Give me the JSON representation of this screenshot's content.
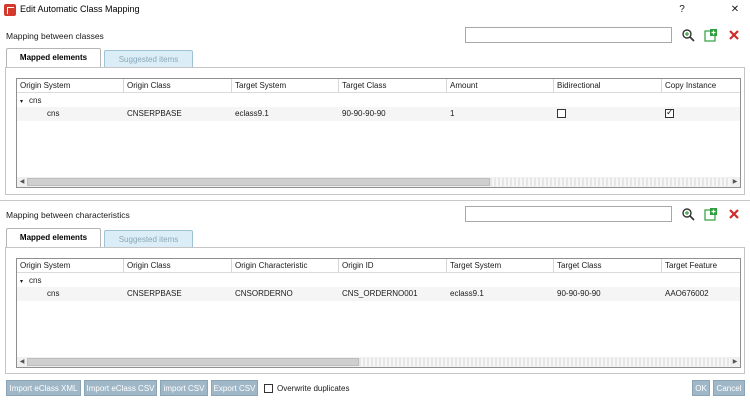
{
  "window": {
    "title": "Edit Automatic Class Mapping",
    "help": "?",
    "close": "✕"
  },
  "classes": {
    "label": "Mapping between classes",
    "search_value": "",
    "tabs": {
      "mapped": "Mapped elements",
      "suggested": "Suggested items"
    },
    "columns": [
      "Origin System",
      "Origin Class",
      "Target System",
      "Target Class",
      "Amount",
      "Bidirectional",
      "Copy Instance"
    ],
    "group": "cns",
    "rows": [
      {
        "origin_system": "cns",
        "origin_class": "CNSERPBASE",
        "target_system": "eclass9.1",
        "target_class": "90-90-90-90",
        "amount": "1",
        "bidirectional": false,
        "copy_instance": true
      }
    ]
  },
  "characteristics": {
    "label": "Mapping between characteristics",
    "search_value": "",
    "tabs": {
      "mapped": "Mapped elements",
      "suggested": "Suggested items"
    },
    "columns": [
      "Origin System",
      "Origin Class",
      "Origin Characteristic",
      "Origin ID",
      "Target System",
      "Target Class",
      "Target Feature"
    ],
    "group": "cns",
    "rows": [
      {
        "origin_system": "cns",
        "origin_class": "CNSERPBASE",
        "origin_characteristic": "CNSORDERNO",
        "origin_id": "CNS_ORDERNO001",
        "target_system": "eclass9.1",
        "target_class": "90-90-90-90",
        "target_feature": "AAO676002"
      }
    ]
  },
  "footer": {
    "import_eclass_xml": "Import eClass XML",
    "import_eclass_csv": "Import eClass CSV",
    "import_csv": "import CSV",
    "export_csv": "Export CSV",
    "overwrite_duplicates": "Overwrite duplicates",
    "ok": "OK",
    "cancel": "Cancel"
  },
  "icons": {
    "search": "search-add-icon",
    "add": "add-green-icon",
    "delete": "delete-red-x-icon"
  },
  "colors": {
    "accent_red": "#d33a2c",
    "add_green": "#2e9e3e",
    "delete_red": "#d12b2b",
    "inactive_tab": "#dbeef7",
    "button_disabled": "#9fb7c6"
  }
}
